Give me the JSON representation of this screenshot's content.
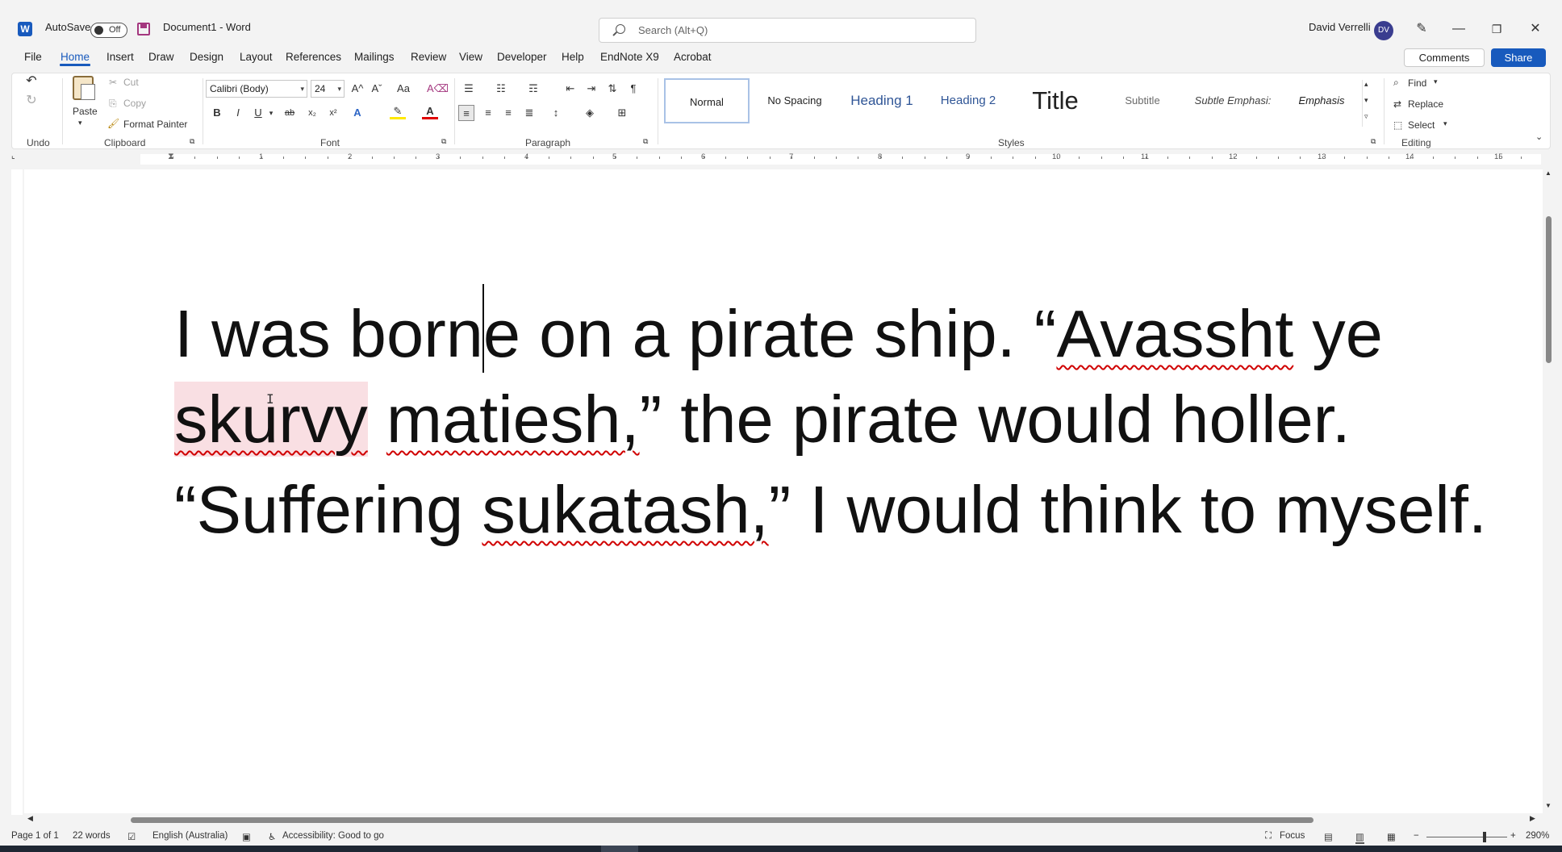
{
  "titlebar": {
    "autosave_label": "AutoSave",
    "autosave_state": "Off",
    "doc_title": "Document1  -  Word",
    "search_placeholder": "Search (Alt+Q)",
    "user_name": "David Verrelli",
    "user_initials": "DV",
    "minimize_glyph": "—",
    "restore_glyph": "❐",
    "close_glyph": "✕",
    "app_letter": "W"
  },
  "menu": {
    "tabs": [
      "File",
      "Home",
      "Insert",
      "Draw",
      "Design",
      "Layout",
      "References",
      "Mailings",
      "Review",
      "View",
      "Developer",
      "Help",
      "EndNote X9",
      "Acrobat"
    ],
    "comments_label": "Comments",
    "share_label": "Share"
  },
  "ribbon": {
    "undo_group": "Undo",
    "clipboard": {
      "group": "Clipboard",
      "paste": "Paste",
      "cut": "Cut",
      "copy": "Copy",
      "format_painter": "Format Painter"
    },
    "font": {
      "group": "Font",
      "family": "Calibri (Body)",
      "size": "24",
      "bold": "B",
      "italic": "I",
      "underline": "U",
      "strike": "ab",
      "subscript": "x₂",
      "superscript": "x²",
      "grow": "A^",
      "shrink": "Aˇ",
      "case": "Aa",
      "text_effects": "A",
      "font_color": "A"
    },
    "paragraph_group": "Paragraph",
    "paragraph_mark": "¶",
    "styles": {
      "group": "Styles",
      "items": [
        "Normal",
        "No Spacing",
        "Heading 1",
        "Heading 2",
        "Title",
        "Subtitle",
        "Subtle Emphasi:",
        "Emphasis"
      ]
    },
    "editing": {
      "group": "Editing",
      "find": "Find",
      "replace": "Replace",
      "select": "Select"
    }
  },
  "ruler": {
    "numbers": [
      "1",
      "2",
      "3",
      "4",
      "5",
      "6",
      "7",
      "8",
      "9",
      "10",
      "11",
      "12",
      "13",
      "14",
      "15"
    ]
  },
  "document": {
    "line1_before_caret": "I was born",
    "line1_after_caret": "e on a pirate ship.  “",
    "line1_misspelled": "Avassht",
    "line1_end": " ye",
    "line2_misspelled_hl": "skurvy",
    "line2_space": " ",
    "line2_misspelled": "matiesh,",
    "line2_end": "” the pirate would holler.",
    "line3_start": "“Suffering ",
    "line3_misspelled": "sukatash,",
    "line3_end": "” I would think to myself."
  },
  "status": {
    "page": "Page 1 of 1",
    "words": "22 words",
    "language": "English (Australia)",
    "accessibility": "Accessibility: Good to go",
    "focus": "Focus",
    "zoom": "290%",
    "zoom_minus": "−",
    "zoom_plus": "+"
  },
  "colors": {
    "word_blue": "#185abd",
    "spell_red": "#d00000",
    "highlight": "#f9dfe3"
  }
}
